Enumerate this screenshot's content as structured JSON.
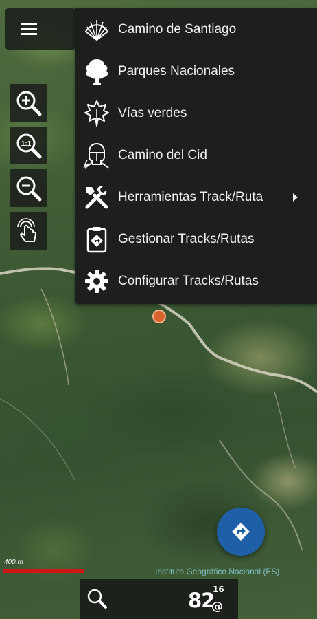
{
  "map": {
    "background_colors": [
      "#3d5a34",
      "#2e4a2a",
      "#7c8a58"
    ],
    "marker_color": "#d9632c"
  },
  "toolbar": {
    "menu_icon": "hamburger-icon",
    "tools": [
      {
        "icon": "zoom-in-icon"
      },
      {
        "icon": "zoom-reset-icon",
        "text": "1:1"
      },
      {
        "icon": "zoom-out-icon"
      },
      {
        "icon": "touch-hand-icon"
      }
    ]
  },
  "menu": {
    "items": [
      {
        "label": "Camino de Santiago",
        "icon": "scallop-shell-icon"
      },
      {
        "label": "Parques Nacionales",
        "icon": "tree-icon"
      },
      {
        "label": "Vías verdes",
        "icon": "leaf-icon"
      },
      {
        "label": "Camino del Cid",
        "icon": "knight-icon"
      },
      {
        "label": "Herramientas Track/Ruta",
        "icon": "tools-icon",
        "submenu": true
      },
      {
        "label": "Gestionar Tracks/Rutas",
        "icon": "clipboard-route-icon"
      },
      {
        "label": "Configurar Tracks/Rutas",
        "icon": "gear-icon"
      }
    ]
  },
  "fab": {
    "icon": "directions-icon",
    "color": "#1f5fa8"
  },
  "scale": {
    "label": "400 m",
    "color": "#d01616"
  },
  "attribution": "Instituto Geográfico Nacional (ES)",
  "status": {
    "search_icon": "search-icon",
    "value": "82",
    "superscript": "16",
    "subscript": "@"
  }
}
